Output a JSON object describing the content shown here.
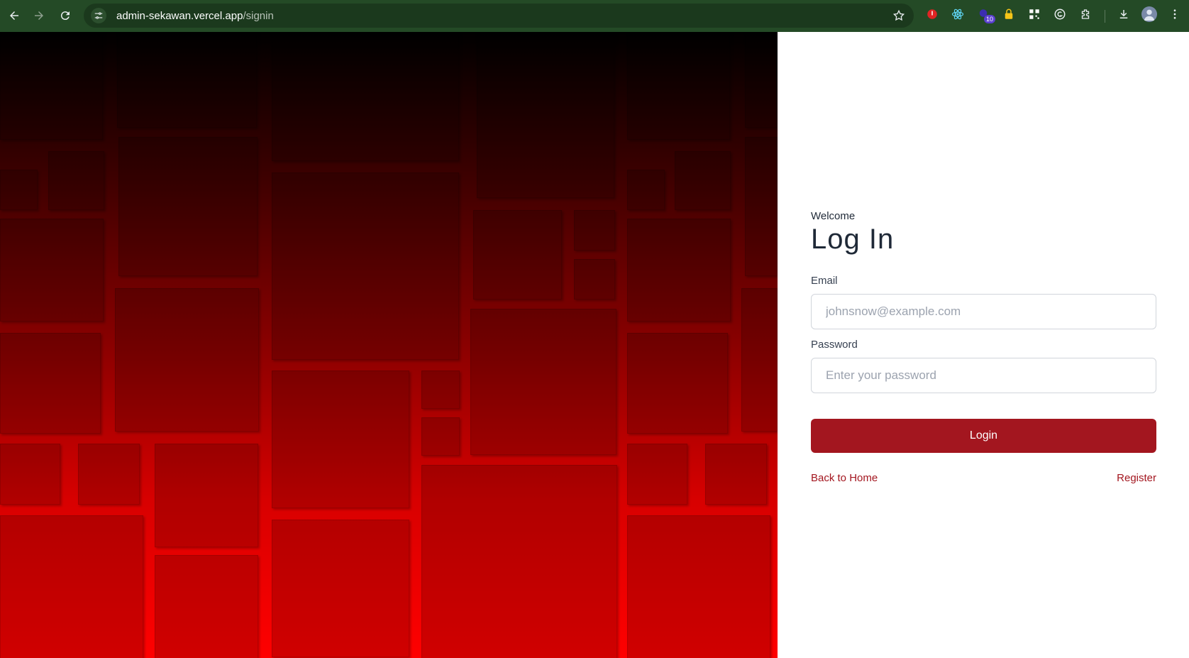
{
  "browser": {
    "url_host": "admin-sekawan.vercel.app",
    "url_path": "/signin",
    "extension_badge": "10",
    "icons": [
      "back-icon",
      "forward-icon",
      "reload-icon",
      "site-info-icon",
      "star-icon",
      "download-icon",
      "profile-avatar",
      "menu-icon"
    ]
  },
  "auth": {
    "welcome": "Welcome",
    "title": "Log In",
    "email_label": "Email",
    "email_placeholder": "johnsnow@example.com",
    "password_label": "Password",
    "password_placeholder": "Enter your password",
    "login_label": "Login",
    "back_link": "Back to Home",
    "register_link": "Register"
  },
  "colors": {
    "toolbar": "#244a26",
    "primary": "#a3161f"
  }
}
